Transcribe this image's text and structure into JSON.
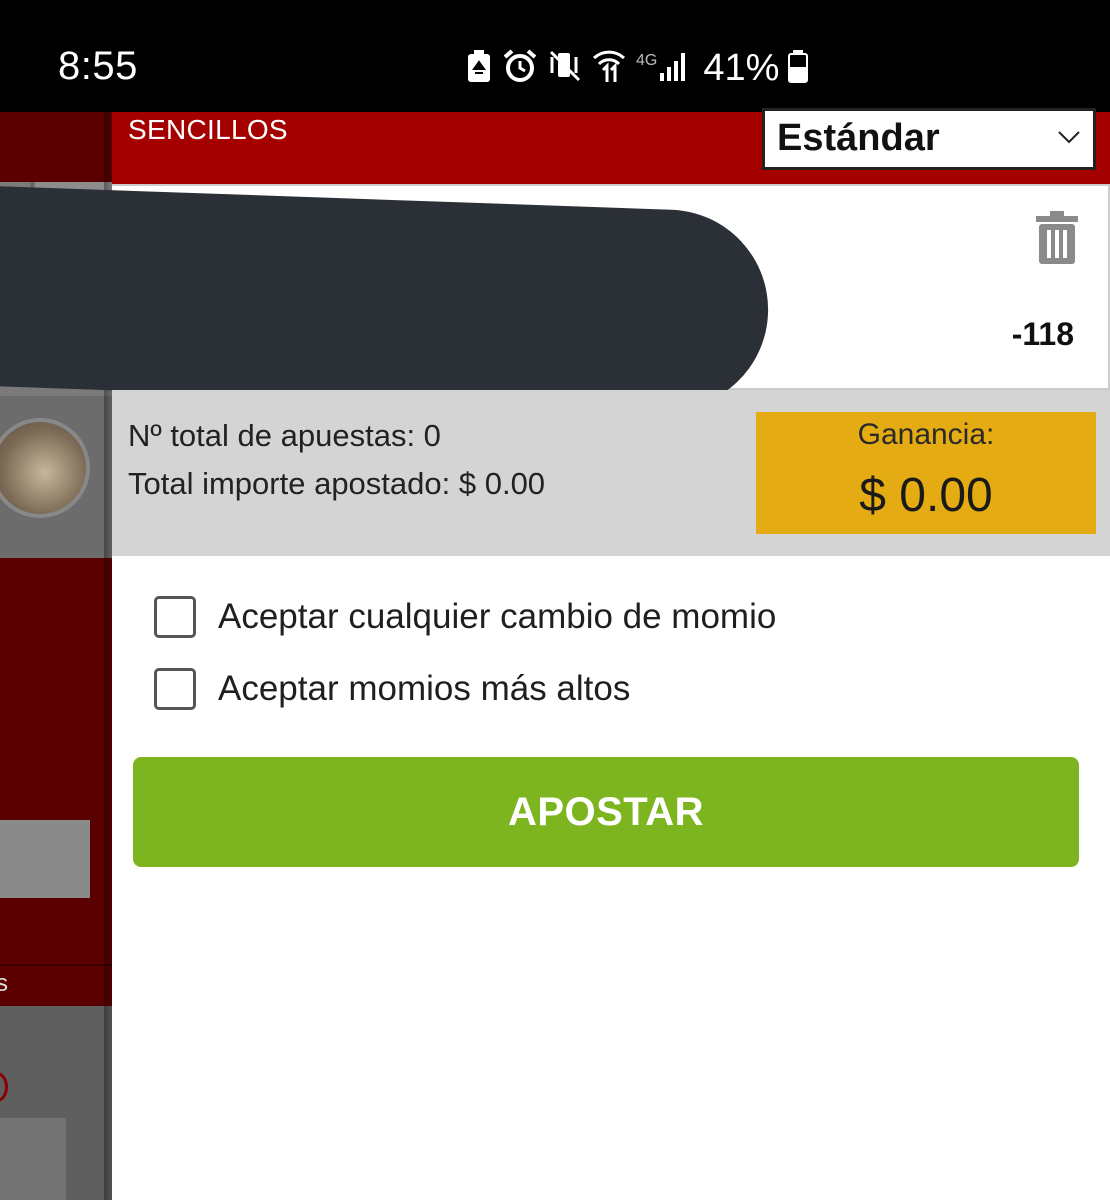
{
  "status_bar": {
    "time": "8:55",
    "battery_percent": "41%",
    "network_label": "4G"
  },
  "background_app": {
    "partial_label": "s"
  },
  "bet_slip": {
    "header_title": "SENCILLOS",
    "stake_mode": {
      "selected": "Estándar"
    },
    "selection": {
      "odds": "-118"
    },
    "summary": {
      "total_bets": "Nº total de apuestas: 0",
      "total_staked": "Total importe apostado: $ 0.00",
      "gain_label": "Ganancia:",
      "gain_value": "$ 0.00"
    },
    "options": [
      {
        "label": "Aceptar cualquier cambio de momio",
        "checked": false
      },
      {
        "label": "Aceptar momios más altos",
        "checked": false
      }
    ],
    "submit_label": "APOSTAR"
  },
  "colors": {
    "header_red": "#a40000",
    "gain_yellow": "#e5ab12",
    "submit_green": "#7cb51f",
    "summary_gray": "#d4d4d4"
  }
}
